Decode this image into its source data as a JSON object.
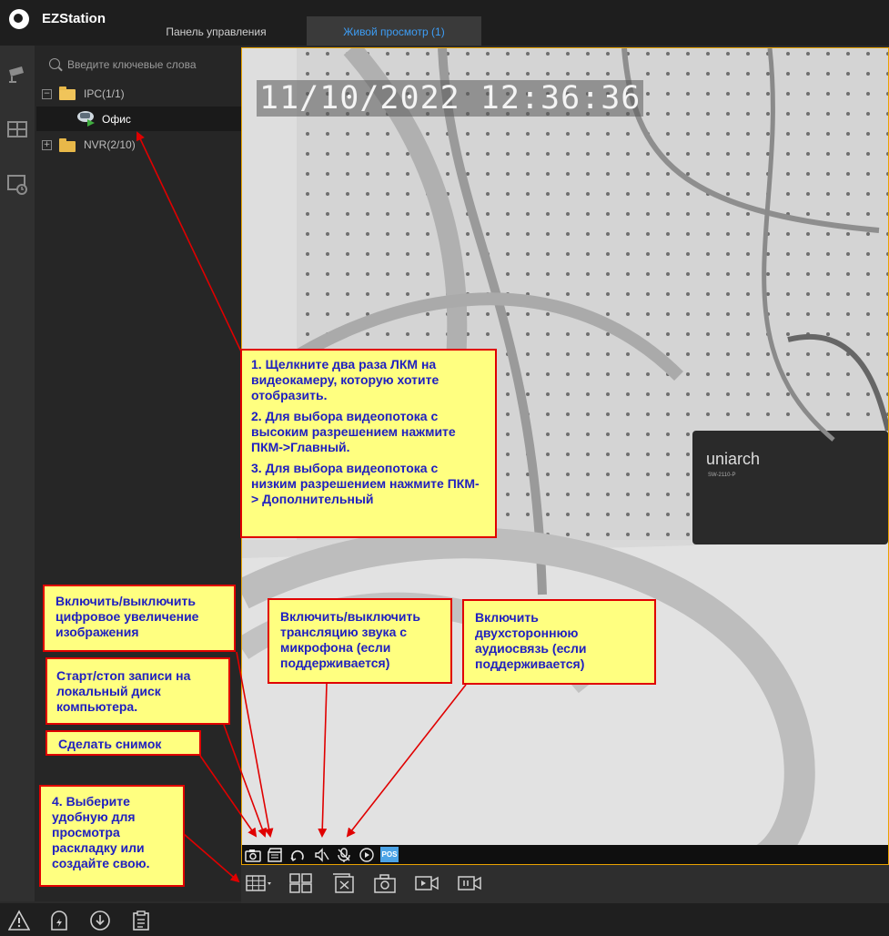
{
  "app": {
    "title": "EZStation"
  },
  "tabs": [
    {
      "label": "Панель управления"
    },
    {
      "label": "Живой просмотр (1)"
    }
  ],
  "left_rail": {
    "icons": [
      "camera-icon",
      "layout-icon",
      "playback-icon"
    ]
  },
  "device_tree": {
    "search_placeholder": "Введите ключевые слова",
    "nodes": [
      {
        "label": "IPC(1/1)",
        "expanded": true,
        "toggle": "−"
      },
      {
        "label": "Офис",
        "selected": true
      },
      {
        "label": "NVR(2/10)",
        "expanded": false,
        "toggle": "+"
      }
    ]
  },
  "video": {
    "timestamp": "11/10/2022 12:36:36",
    "pos_label": "POS",
    "device_brand": "uniarch",
    "device_model": "SW-2110-P",
    "toolbar_icons": [
      "snapshot-icon",
      "record-icon",
      "digital-zoom-icon",
      "audio-icon",
      "microphone-icon",
      "playback-icon",
      "pos-icon"
    ]
  },
  "layout_bar": {
    "icons": [
      "grid-layout-icon",
      "custom-layout-icon",
      "close-all-icon",
      "snapshot-all-icon",
      "record-all-icon",
      "playback-all-icon"
    ]
  },
  "status_bar": {
    "icons": [
      "alarm-icon",
      "event-icon",
      "download-icon",
      "log-icon"
    ]
  },
  "callouts": {
    "c1": [
      "1. Щелкните два раза ЛКМ на видеокамеру, которую хотите отобразить.",
      "2. Для выбора видеопотока с высоким разрешением нажмите ПКМ->Главный.",
      "3. Для выбора видеопотока с низким разрешением нажмите ПКМ-> Дополнительный"
    ],
    "zoom": "Включить/выключить цифровое увеличение изображения",
    "record": "Старт/стоп записи на локальный диск компьютера.",
    "snapshot": "Сделать снимок",
    "layout": "4. Выберите удобную для просмотра раскладку или создайте свою.",
    "audio": "Включить/выключить трансляцию звука с микрофона (если поддерживается)",
    "talk": "Включить двухстороннюю аудиосвязь (если поддерживается)"
  },
  "colors": {
    "accent": "#3d9df5",
    "active_border": "#e8a200",
    "callout_bg": "#ffff80",
    "callout_border": "#e00000",
    "callout_text": "#2020c0"
  }
}
